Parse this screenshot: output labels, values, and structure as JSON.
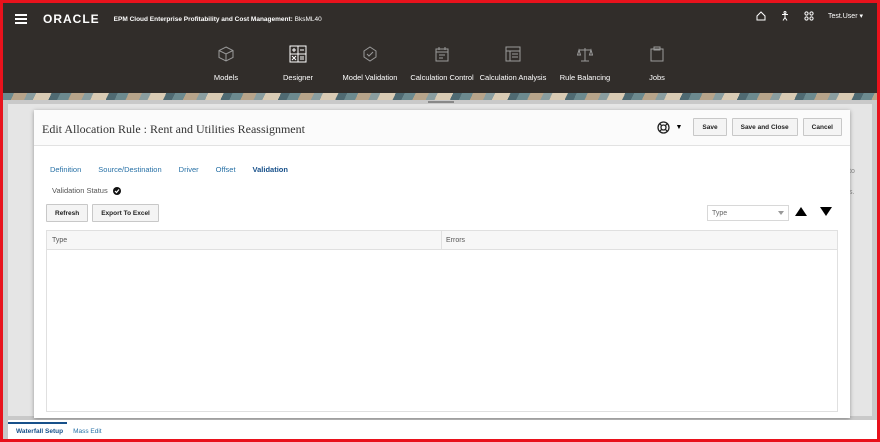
{
  "app": {
    "logo": "ORACLE",
    "title_bold": "EPM Cloud Enterprise Profitability and Cost Management:",
    "title_app": "BksML40",
    "user": "Test.User"
  },
  "nav": [
    {
      "label": "Models",
      "icon": "cube-icon"
    },
    {
      "label": "Designer",
      "icon": "calculator-icon"
    },
    {
      "label": "Model Validation",
      "icon": "validation-icon"
    },
    {
      "label": "Calculation Control",
      "icon": "calendar-icon"
    },
    {
      "label": "Calculation Analysis",
      "icon": "analysis-icon"
    },
    {
      "label": "Rule Balancing",
      "icon": "balance-icon"
    },
    {
      "label": "Jobs",
      "icon": "clipboard-icon"
    }
  ],
  "dialog": {
    "title": "Edit Allocation Rule : Rent and Utilities Reassignment",
    "save": "Save",
    "save_close": "Save and Close",
    "cancel": "Cancel",
    "tabs": [
      "Definition",
      "Source/Destination",
      "Driver",
      "Offset",
      "Validation"
    ],
    "active_tab": "Validation",
    "validation_status_label": "Validation Status",
    "refresh": "Refresh",
    "export": "Export To Excel",
    "sort_select": "Type",
    "columns": [
      "Type",
      "Errors"
    ],
    "rows": []
  },
  "background": {
    "text1": "to",
    "text2": "s."
  },
  "bottom_tabs": [
    "Waterfall Setup",
    "Mass Edit"
  ],
  "colors": {
    "topbar": "#312d2a",
    "link": "#2871a6",
    "frame": "#e8121c"
  }
}
